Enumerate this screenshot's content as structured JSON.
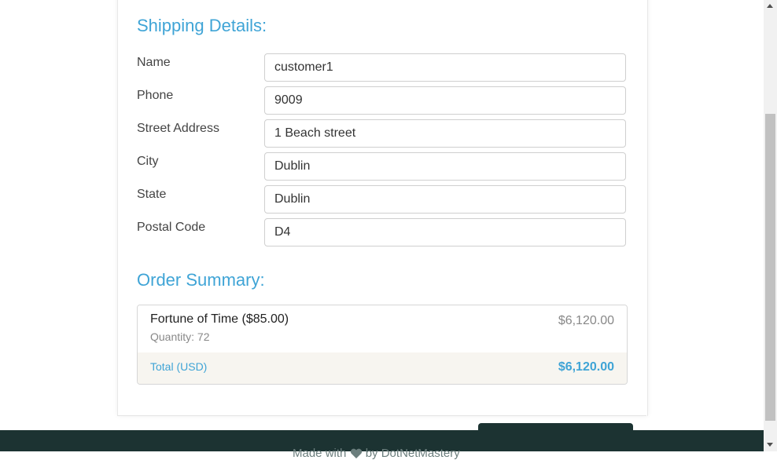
{
  "shipping": {
    "title": "Shipping Details:",
    "fields": [
      {
        "label": "Name",
        "value": "customer1"
      },
      {
        "label": "Phone",
        "value": "9009"
      },
      {
        "label": "Street Address",
        "value": "1 Beach street"
      },
      {
        "label": "City",
        "value": "Dublin"
      },
      {
        "label": "State",
        "value": "Dublin"
      },
      {
        "label": "Postal Code",
        "value": "D4"
      }
    ]
  },
  "summary": {
    "title": "Order Summary:",
    "item": {
      "name": "Fortune of Time ($85.00)",
      "quantity": "Quantity: 72",
      "price": "$6,120.00"
    },
    "total_label": "Total (USD)",
    "total_value": "$6,120.00"
  },
  "footer": {
    "made_with": "Made with",
    "by_text": "by DotNetMastery",
    "heart_icon": "heart-icon"
  },
  "colors": {
    "accent": "#3fa4d6",
    "footer_bg": "#1c3332"
  }
}
